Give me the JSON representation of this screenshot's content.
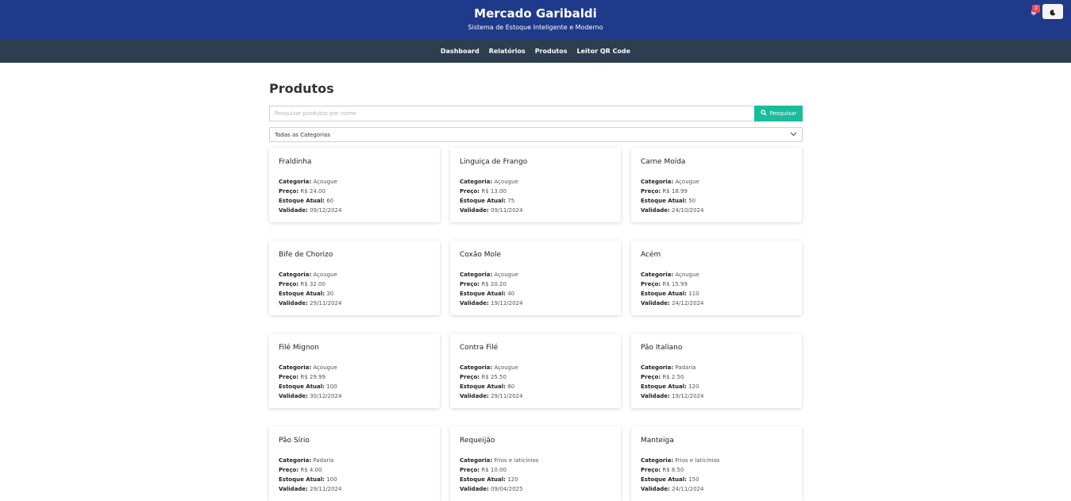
{
  "header": {
    "title": "Mercado Garibaldi",
    "subtitle": "Sistema de Estoque Inteligente e Moderno",
    "notification_count": "2",
    "theme_icon": "moon-icon",
    "bell_icon": "bell-icon",
    "colors": {
      "header_bg": "#1f3a8a",
      "nav_bg": "#2c3e50",
      "accent": "#1abc9c",
      "badge": "#e74c5c"
    }
  },
  "nav": {
    "items": [
      {
        "label": "Dashboard"
      },
      {
        "label": "Relatórios"
      },
      {
        "label": "Produtos"
      },
      {
        "label": "Leitor QR Code"
      }
    ]
  },
  "page": {
    "title": "Produtos",
    "search_placeholder": "Pesquisar produtos por nome",
    "search_button": "Pesquisar",
    "category_selected": "Todas as Categorias"
  },
  "labels": {
    "category": "Categoria:",
    "price": "Preço:",
    "stock": "Estoque Atual:",
    "validity": "Validade:"
  },
  "products": [
    {
      "name": "Fraldinha",
      "category": "Açougue",
      "price": "R$ 24.00",
      "stock": "60",
      "validity": "09/12/2024"
    },
    {
      "name": "Linguiça de Frango",
      "category": "Açougue",
      "price": "R$ 13.00",
      "stock": "75",
      "validity": "09/11/2024"
    },
    {
      "name": "Carne Moída",
      "category": "Açougue",
      "price": "R$ 18.99",
      "stock": "50",
      "validity": "24/10/2024"
    },
    {
      "name": "Bife de Chorizo",
      "category": "Açougue",
      "price": "R$ 32.00",
      "stock": "30",
      "validity": "29/11/2024"
    },
    {
      "name": "Coxão Mole",
      "category": "Açougue",
      "price": "R$ 20.20",
      "stock": "40",
      "validity": "19/12/2024"
    },
    {
      "name": "Acém",
      "category": "Açougue",
      "price": "R$ 15.99",
      "stock": "110",
      "validity": "24/12/2024"
    },
    {
      "name": "Filé Mignon",
      "category": "Açougue",
      "price": "R$ 29.99",
      "stock": "100",
      "validity": "30/12/2024"
    },
    {
      "name": "Contra Filé",
      "category": "Açougue",
      "price": "R$ 25.50",
      "stock": "80",
      "validity": "29/11/2024"
    },
    {
      "name": "Pão Italiano",
      "category": "Padaria",
      "price": "R$ 2.50",
      "stock": "120",
      "validity": "19/12/2024"
    },
    {
      "name": "Pão Sírio",
      "category": "Padaria",
      "price": "R$ 4.00",
      "stock": "100",
      "validity": "29/11/2024"
    },
    {
      "name": "Requeijão",
      "category": "Frios e laticínios",
      "price": "R$ 10.00",
      "stock": "120",
      "validity": "09/04/2025"
    },
    {
      "name": "Manteiga",
      "category": "Frios e laticínios",
      "price": "R$ 8.50",
      "stock": "150",
      "validity": "24/11/2024"
    }
  ]
}
